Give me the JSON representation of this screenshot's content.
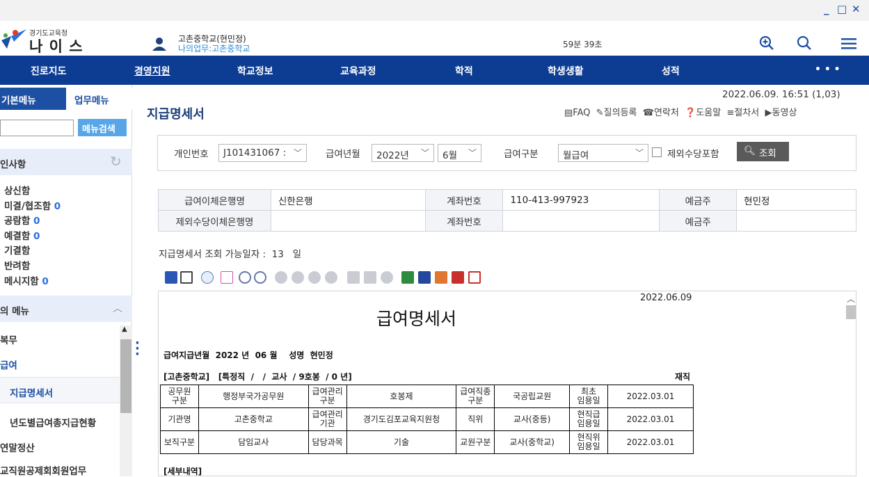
{
  "window": {
    "min": "_",
    "max": "□",
    "close": "✕"
  },
  "header": {
    "logo_small": "경기도교육청",
    "logo_main": "나 이 스",
    "user_school": "고촌중학교(현민정)",
    "user_work": "나의업무:고촌중학교",
    "timer": "59분 39초"
  },
  "nav": [
    "진로지도",
    "경영지원",
    "학교정보",
    "교육과정",
    "학적",
    "학생생활",
    "성적",
    "• • •"
  ],
  "sidebar": {
    "tab_basic": "기본메뉴",
    "tab_work": "업무메뉴",
    "search_btn": "메뉴검색",
    "approval_title": "인사항",
    "approval_items": [
      {
        "label": "상신함",
        "count": ""
      },
      {
        "label": "미결/협조함",
        "count": "0"
      },
      {
        "label": "공람함",
        "count": "0"
      },
      {
        "label": "예결함",
        "count": "0"
      },
      {
        "label": "기결함",
        "count": ""
      },
      {
        "label": "반려함",
        "count": ""
      },
      {
        "label": "메시지함",
        "count": "0"
      }
    ],
    "mymenu_title": "의 메뉴",
    "menu_items": [
      "복무",
      "급여",
      "지급명세서",
      "년도별급여총지급현황",
      "연말정산",
      "교직원공제회회원업무"
    ]
  },
  "main": {
    "datetime": "2022.06.09. 16:51 (1,03)",
    "title": "지급명세서",
    "links": [
      "FAQ",
      "질의등록",
      "연락처",
      "도움말",
      "절차서",
      "동영상"
    ],
    "search": {
      "personal_label": "개인번호",
      "personal_value": "J101431067 :",
      "year_label": "급여년월",
      "year_value": "2022년",
      "month_value": "6월",
      "type_label": "급여구분",
      "type_value": "월급여",
      "exclude_label": "제외수당포함",
      "query_btn": "조회"
    },
    "account": {
      "bank_label": "급여이체은행명",
      "bank_value": "신한은행",
      "acct_label": "계좌번호",
      "acct_value": "110-413-997923",
      "holder_label": "예금주",
      "holder_value": "현민정",
      "bank2_label": "제외수당이체은행명",
      "bank2_value": "",
      "acct2_label": "계좌번호",
      "acct2_value": "",
      "holder2_label": "예금주",
      "holder2_value": ""
    },
    "available": "지급명세서 조회 가능일자 :  13   일"
  },
  "report": {
    "date": "2022.06.09",
    "title": "급여명세서",
    "line1": "급여지급년월  2022 년  06 월    성명  현민정",
    "line2": "[고촌중학교]   [특정직  /   /  교사  / 9호봉  / 0 년]",
    "status": "재직",
    "rows": [
      [
        "공무원\n구분",
        "행정부국가공무원",
        "급여관리\n구분",
        "호봉제",
        "급여직종\n구분",
        "국공립교원",
        "최초\n임용일",
        "2022.03.01"
      ],
      [
        "기관명",
        "고촌중학교",
        "급여관리\n기관",
        "경기도김포교육지원청",
        "직위",
        "교사(중등)",
        "현직급\n임용일",
        "2022.03.01"
      ],
      [
        "보직구분",
        "담임교사",
        "담당과목",
        "기술",
        "교원구분",
        "교사(중학교)",
        "현직위\n임용일",
        "2022.03.01"
      ]
    ],
    "next_section": "[세부내역]"
  }
}
